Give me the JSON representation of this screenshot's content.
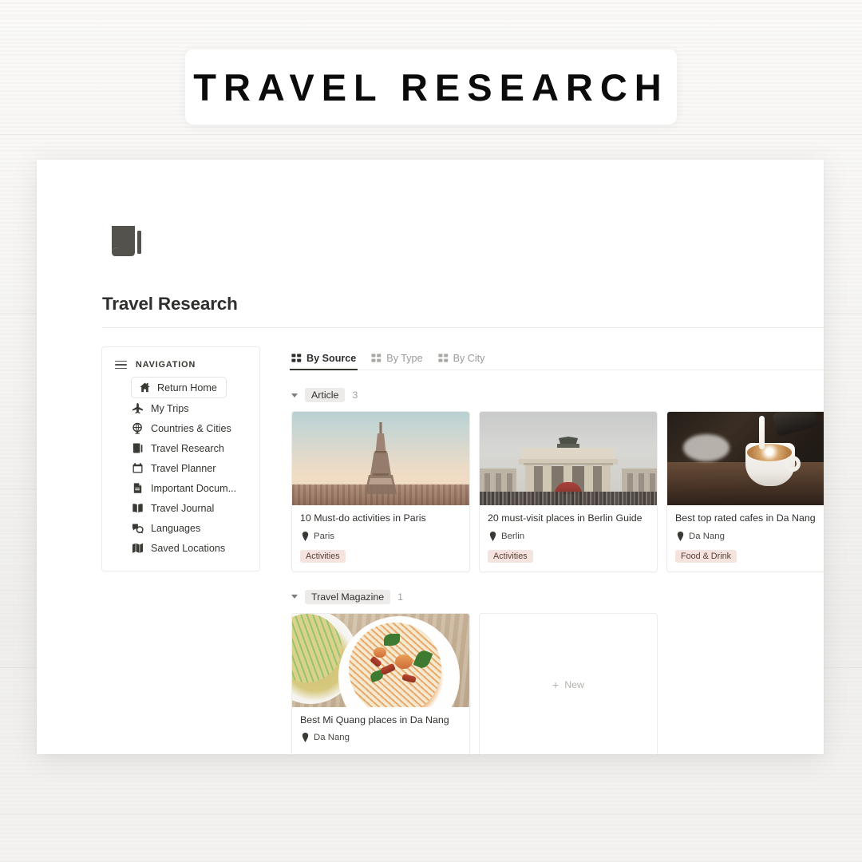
{
  "banner": {
    "title": "TRAVEL RESEARCH"
  },
  "page": {
    "icon_name": "notebook-icon",
    "title": "Travel Research"
  },
  "sidebar": {
    "title": "NAVIGATION",
    "menu_icon": "hamburger-icon",
    "home_button": {
      "label": "Return Home",
      "icon": "home-icon"
    },
    "items": [
      {
        "label": "My Trips",
        "icon": "airplane-icon"
      },
      {
        "label": "Countries & Cities",
        "icon": "globe-icon"
      },
      {
        "label": "Travel Research",
        "icon": "books-icon"
      },
      {
        "label": "Travel Planner",
        "icon": "calendar-icon"
      },
      {
        "label": "Important Docum...",
        "icon": "document-icon"
      },
      {
        "label": "Travel Journal",
        "icon": "open-book-icon"
      },
      {
        "label": "Languages",
        "icon": "translate-icon"
      },
      {
        "label": "Saved Locations",
        "icon": "map-icon"
      }
    ]
  },
  "main": {
    "tabs": [
      {
        "label": "By Source",
        "icon": "gallery-grid-icon",
        "active": true
      },
      {
        "label": "By Type",
        "icon": "gallery-grid-icon",
        "active": false
      },
      {
        "label": "By City",
        "icon": "gallery-grid-icon",
        "active": false
      }
    ],
    "groups": [
      {
        "name": "Article",
        "count": "3",
        "cards": [
          {
            "title": "10 Must-do activities in Paris",
            "location": "Paris",
            "tag": "Activities",
            "image": "eiffel-tower-photo"
          },
          {
            "title": "20 must-visit places in Berlin Guide",
            "location": "Berlin",
            "tag": "Activities",
            "image": "brandenburg-gate-photo"
          },
          {
            "title": "Best top rated cafes in Da Nang",
            "location": "Da Nang",
            "tag": "Food & Drink",
            "image": "latte-pour-photo"
          }
        ]
      },
      {
        "name": "Travel Magazine",
        "count": "1",
        "cards": [
          {
            "title": "Best Mi Quang places in Da Nang",
            "location": "Da Nang",
            "tag": "",
            "image": "mi-quang-noodles-photo"
          }
        ],
        "new_card": {
          "label": "New",
          "icon": "plus-icon"
        }
      }
    ]
  },
  "colors": {
    "tag_bg": "#f4e3de",
    "tag_text": "#5d4038",
    "chip_bg": "#ecebe9",
    "text_primary": "#32302c",
    "text_muted": "#9b9a96",
    "accent_underline": "#37352f"
  }
}
